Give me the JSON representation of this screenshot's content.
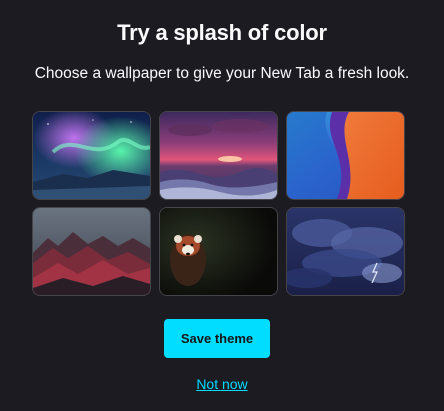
{
  "dialog": {
    "title": "Try a splash of color",
    "subtitle": "Choose a wallpaper to give your New Tab a fresh look."
  },
  "wallpapers": [
    {
      "icon": "aurora-wallpaper"
    },
    {
      "icon": "ocean-sunset-wallpaper"
    },
    {
      "icon": "abstract-orange-blue-wallpaper"
    },
    {
      "icon": "red-mountains-wallpaper"
    },
    {
      "icon": "red-panda-wallpaper"
    },
    {
      "icon": "stormy-clouds-wallpaper"
    }
  ],
  "actions": {
    "save_label": "Save theme",
    "not_now_label": "Not now"
  },
  "colors": {
    "background": "#1c1b22",
    "accent": "#00ddff",
    "text": "#fbfbfe"
  }
}
